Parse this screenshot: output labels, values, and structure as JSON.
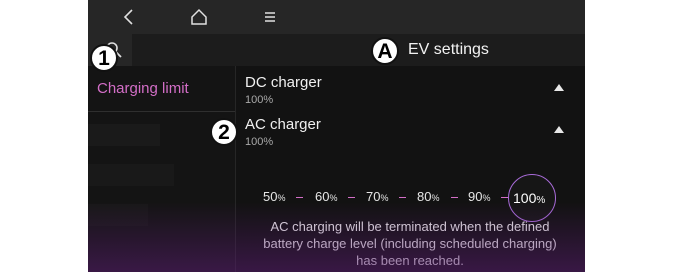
{
  "nav": {
    "back_icon": "back-arrow-icon",
    "home_icon": "home-icon",
    "menu_icon": "menu-icon"
  },
  "header": {
    "search_icon": "search-icon",
    "title": "EV settings"
  },
  "callouts": {
    "one": "1",
    "a": "A",
    "two": "2"
  },
  "sidebar": {
    "items": [
      {
        "label": "Charging limit",
        "active": true
      }
    ]
  },
  "chargers": [
    {
      "name": "DC charger",
      "value": "100%"
    },
    {
      "name": "AC charger",
      "value": "100%"
    }
  ],
  "levels": {
    "options": [
      "50",
      "60",
      "70",
      "80",
      "90",
      "100"
    ],
    "unit": "%",
    "selected": "100"
  },
  "info": {
    "line1": "AC charging will be terminated when the defined",
    "line2": "battery charge level (including scheduled charging)",
    "line3": "has been reached."
  },
  "colors": {
    "accent": "#d36ec7",
    "selected_ring": "#a86bd9",
    "background": "#121212"
  }
}
